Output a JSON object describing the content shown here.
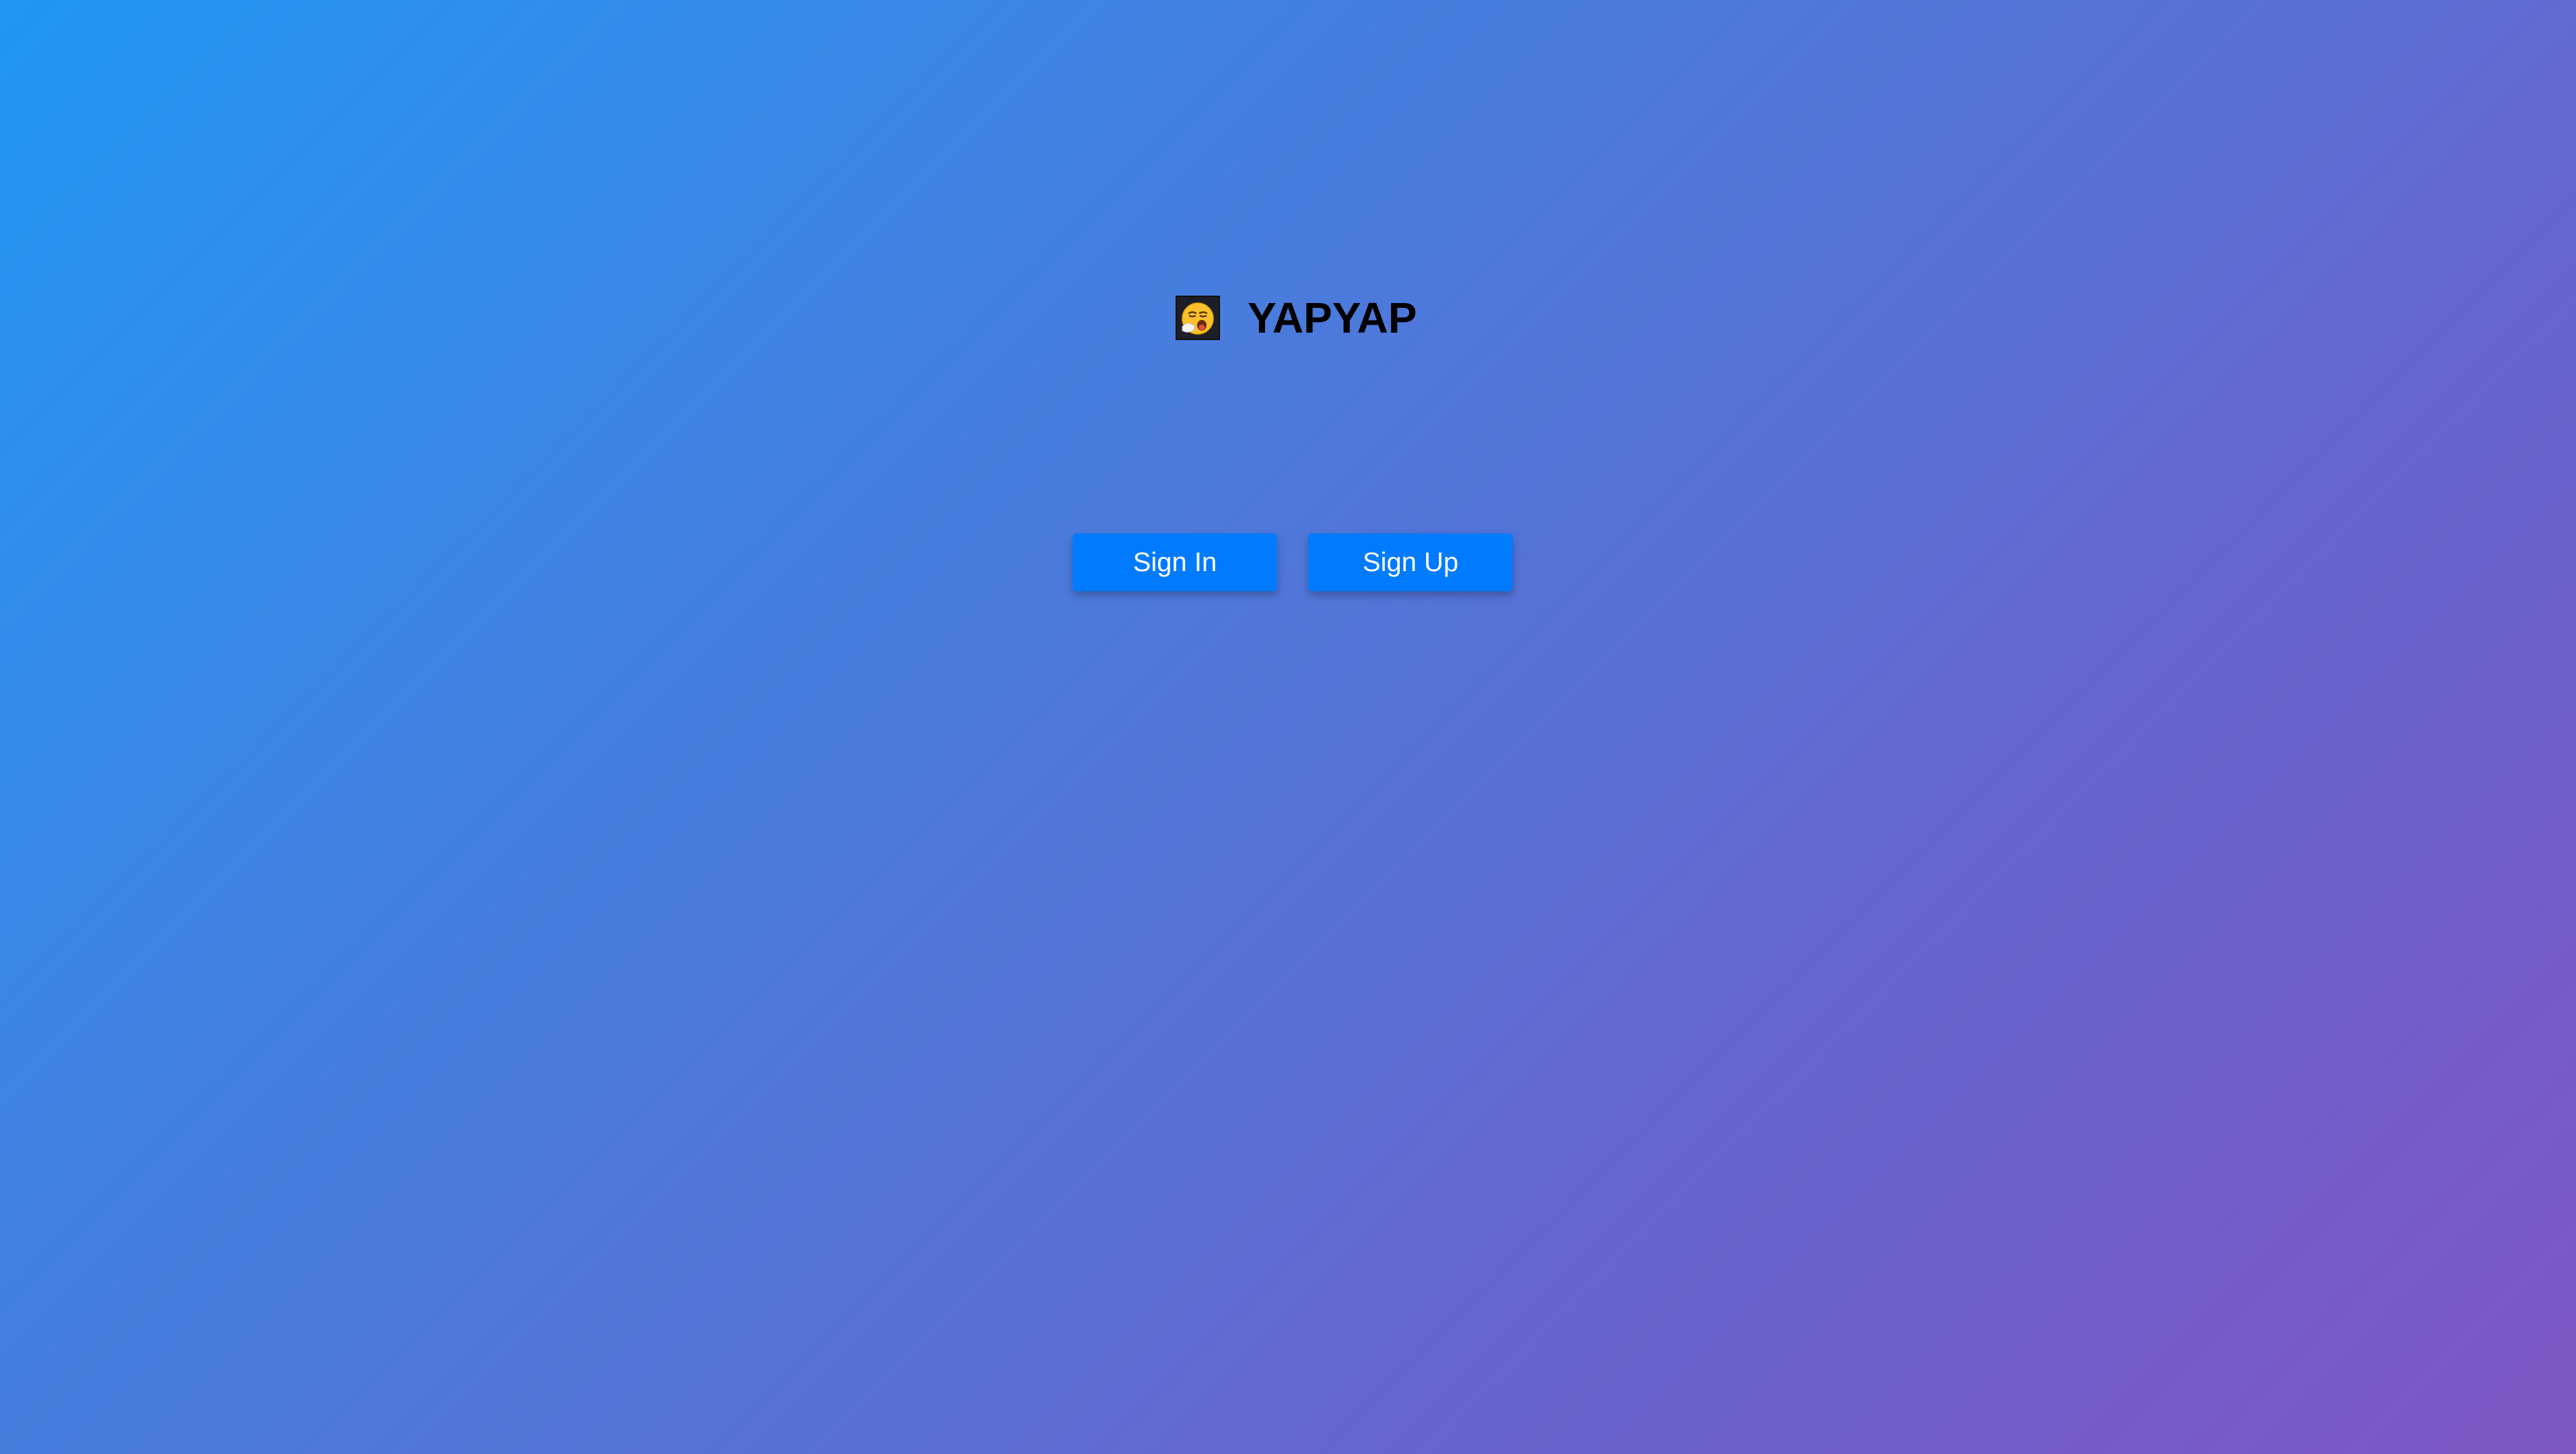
{
  "app": {
    "title": "YAPYAP",
    "logo_icon": "yawning-face-icon"
  },
  "actions": {
    "sign_in_label": "Sign In",
    "sign_up_label": "Sign Up"
  },
  "colors": {
    "background_start": "#2196f3",
    "background_end": "#7e57c2",
    "button": "#007bff",
    "button_text": "#ffffff",
    "title_text": "#000000"
  }
}
